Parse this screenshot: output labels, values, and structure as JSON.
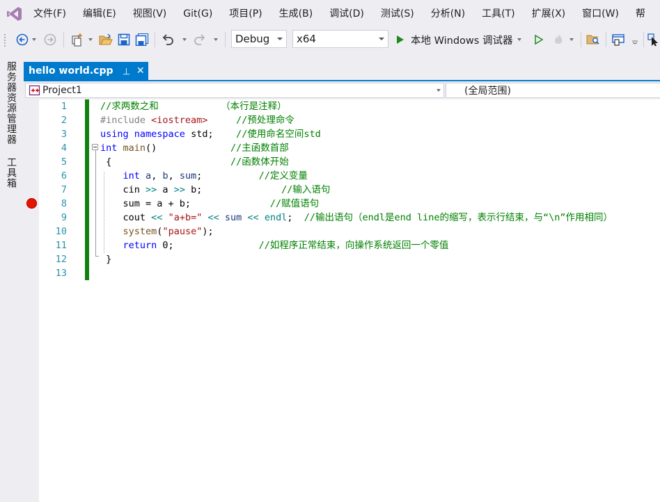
{
  "menu": {
    "items": [
      "文件(F)",
      "编辑(E)",
      "视图(V)",
      "Git(G)",
      "项目(P)",
      "生成(B)",
      "调试(D)",
      "测试(S)",
      "分析(N)",
      "工具(T)",
      "扩展(X)",
      "窗口(W)",
      "帮"
    ]
  },
  "toolbar": {
    "configuration": "Debug",
    "platform": "x64",
    "start_label": "本地 Windows 调试器",
    "accent_green": "#1e8a1e",
    "accent_blue": "#1e64c8"
  },
  "side_panel": {
    "tabs": [
      "服务器资源管理器",
      "工具箱"
    ]
  },
  "document_tab": {
    "title": "hello world.cpp",
    "pin_glyph": "⊣",
    "close_glyph": "✕",
    "color": "#007acc"
  },
  "navbar": {
    "project": "Project1",
    "scope": "(全局范围)"
  },
  "editor": {
    "breakpoint_line": 8,
    "line_numbers": [
      "1",
      "2",
      "3",
      "4",
      "5",
      "6",
      "7",
      "8",
      "9",
      "10",
      "11",
      "12",
      "13"
    ],
    "lines": [
      [
        {
          "t": "//求两数之和           （本行是注释）",
          "c": "comment"
        }
      ],
      [
        {
          "t": "#include ",
          "c": "pre"
        },
        {
          "t": "<iostream>",
          "c": "inc"
        },
        {
          "t": "     //预处理命令",
          "c": "comment"
        }
      ],
      [
        {
          "t": "using",
          "c": "keyword"
        },
        {
          "t": " ",
          "c": "plain"
        },
        {
          "t": "namespace",
          "c": "keyword"
        },
        {
          "t": " std;    ",
          "c": "plain"
        },
        {
          "t": "//使用命名空间std",
          "c": "comment"
        }
      ],
      [
        {
          "t": "int",
          "c": "keyword"
        },
        {
          "t": " ",
          "c": "plain"
        },
        {
          "t": "main",
          "c": "fn"
        },
        {
          "t": "()             ",
          "c": "plain"
        },
        {
          "t": "//主函数首部",
          "c": "comment"
        }
      ],
      [
        {
          "t": " {                     ",
          "c": "plain"
        },
        {
          "t": "//函数体开始",
          "c": "comment"
        }
      ],
      [
        {
          "t": "    ",
          "c": "plain"
        },
        {
          "t": "int",
          "c": "keyword"
        },
        {
          "t": " ",
          "c": "plain"
        },
        {
          "t": "a",
          "c": "var"
        },
        {
          "t": ", ",
          "c": "plain"
        },
        {
          "t": "b",
          "c": "var"
        },
        {
          "t": ", ",
          "c": "plain"
        },
        {
          "t": "sum",
          "c": "var"
        },
        {
          "t": ";          ",
          "c": "plain"
        },
        {
          "t": "//定义变量",
          "c": "comment"
        }
      ],
      [
        {
          "t": "    cin ",
          "c": "plain"
        },
        {
          "t": ">>",
          "c": "op"
        },
        {
          "t": " a ",
          "c": "plain"
        },
        {
          "t": ">>",
          "c": "op"
        },
        {
          "t": " b;              ",
          "c": "plain"
        },
        {
          "t": "//输入语句",
          "c": "comment"
        }
      ],
      [
        {
          "t": "    sum = a + b;              ",
          "c": "plain"
        },
        {
          "t": "//赋值语句",
          "c": "comment"
        }
      ],
      [
        {
          "t": "    cout ",
          "c": "plain"
        },
        {
          "t": "<<",
          "c": "op"
        },
        {
          "t": " ",
          "c": "plain"
        },
        {
          "t": "\"a+b=\"",
          "c": "str"
        },
        {
          "t": " ",
          "c": "plain"
        },
        {
          "t": "<<",
          "c": "op"
        },
        {
          "t": " ",
          "c": "plain"
        },
        {
          "t": "sum",
          "c": "var"
        },
        {
          "t": " ",
          "c": "plain"
        },
        {
          "t": "<<",
          "c": "op"
        },
        {
          "t": " ",
          "c": "plain"
        },
        {
          "t": "endl",
          "c": "op"
        },
        {
          "t": ";  ",
          "c": "plain"
        },
        {
          "t": "//输出语句（endl是end line的缩写，表示行结束，与“\\n”作用相同）",
          "c": "comment"
        }
      ],
      [
        {
          "t": "    ",
          "c": "plain"
        },
        {
          "t": "system",
          "c": "fn"
        },
        {
          "t": "(",
          "c": "plain"
        },
        {
          "t": "\"pause\"",
          "c": "str"
        },
        {
          "t": ");",
          "c": "plain"
        }
      ],
      [
        {
          "t": "    ",
          "c": "plain"
        },
        {
          "t": "return",
          "c": "keyword"
        },
        {
          "t": " 0;               ",
          "c": "plain"
        },
        {
          "t": "//如程序正常结束，向操作系统返回一个零值",
          "c": "comment"
        }
      ],
      [
        {
          "t": " }",
          "c": "plain"
        }
      ],
      []
    ]
  }
}
